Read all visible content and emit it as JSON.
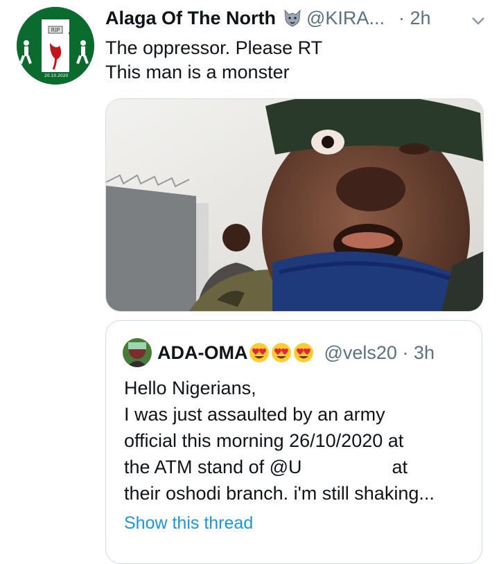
{
  "tweet": {
    "author_name": "Alaga Of The North",
    "author_badge_icon": "wolf-face-icon",
    "handle": "@KIRA...",
    "time": "· 2h",
    "text_line1": "The oppressor. Please RT",
    "text_line2": "This man is a monster",
    "avatar_caption": "20.10.2020",
    "media_icon": "video-thumbnail"
  },
  "quoted_tweet": {
    "author_name": "ADA-OMA",
    "emojis": [
      "heart-eyes-icon",
      "heart-eyes-icon",
      "heart-eyes-icon"
    ],
    "handle": "@vels20 · 3h",
    "line1": "Hello Nigerians,",
    "line2": "I was just assaulted by an army",
    "line3": "official this morning 26/10/2020 at",
    "line4a": "the ATM stand of @U",
    "line4b": "at",
    "line5": "their oshodi branch. i'm still shaking...",
    "show_thread": "Show this thread"
  },
  "colors": {
    "link": "#1b95e0",
    "secondary_text": "#5b7083",
    "primary_text": "#0f1419",
    "border": "#cfd9de"
  }
}
